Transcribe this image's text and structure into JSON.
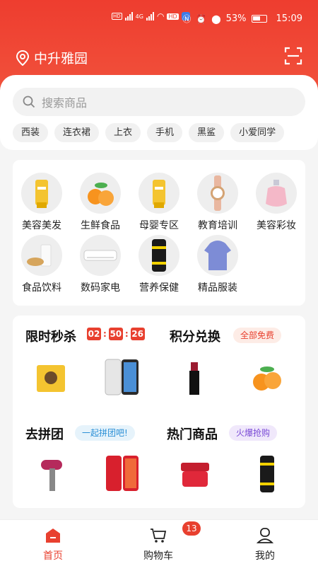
{
  "status": {
    "signal_hd1": "HD 1",
    "signal_hd2": "HD 2",
    "net1": "4G",
    "net2": "4G",
    "battery_text": "53%",
    "time": "15:09"
  },
  "header": {
    "location": "中升雅园",
    "location_icon": "location-pin-icon",
    "scan_icon": "scan-icon"
  },
  "search": {
    "placeholder": "搜索商品",
    "tags": [
      "西装",
      "连衣裙",
      "上衣",
      "手机",
      "黑鲨",
      "小爱同学"
    ]
  },
  "categories": [
    {
      "label": "美容美发",
      "icon": "cosmetics-tube"
    },
    {
      "label": "生鲜食品",
      "icon": "oranges"
    },
    {
      "label": "母婴专区",
      "icon": "baby-tube"
    },
    {
      "label": "教育培训",
      "icon": "watch"
    },
    {
      "label": "美容彩妆",
      "icon": "perfume"
    },
    {
      "label": "食品饮料",
      "icon": "milk-bread"
    },
    {
      "label": "数码家电",
      "icon": "air-conditioner"
    },
    {
      "label": "营养保健",
      "icon": "energy-can"
    },
    {
      "label": "精品服装",
      "icon": "hoodie"
    }
  ],
  "promo": {
    "flash_sale": {
      "title": "限时秒杀",
      "timer": [
        "02",
        "50",
        "26"
      ]
    },
    "points": {
      "title": "积分兑换",
      "pill": "全部免费"
    },
    "group": {
      "title": "去拼团",
      "pill": "一起拼团吧!"
    },
    "hot": {
      "title": "热门商品",
      "pill": "火爆抢购"
    }
  },
  "nav": {
    "home": "首页",
    "cart": "购物车",
    "cart_badge": "13",
    "mine": "我的"
  },
  "colors": {
    "brand": "#e8402f",
    "header": "#ee3d2f"
  }
}
